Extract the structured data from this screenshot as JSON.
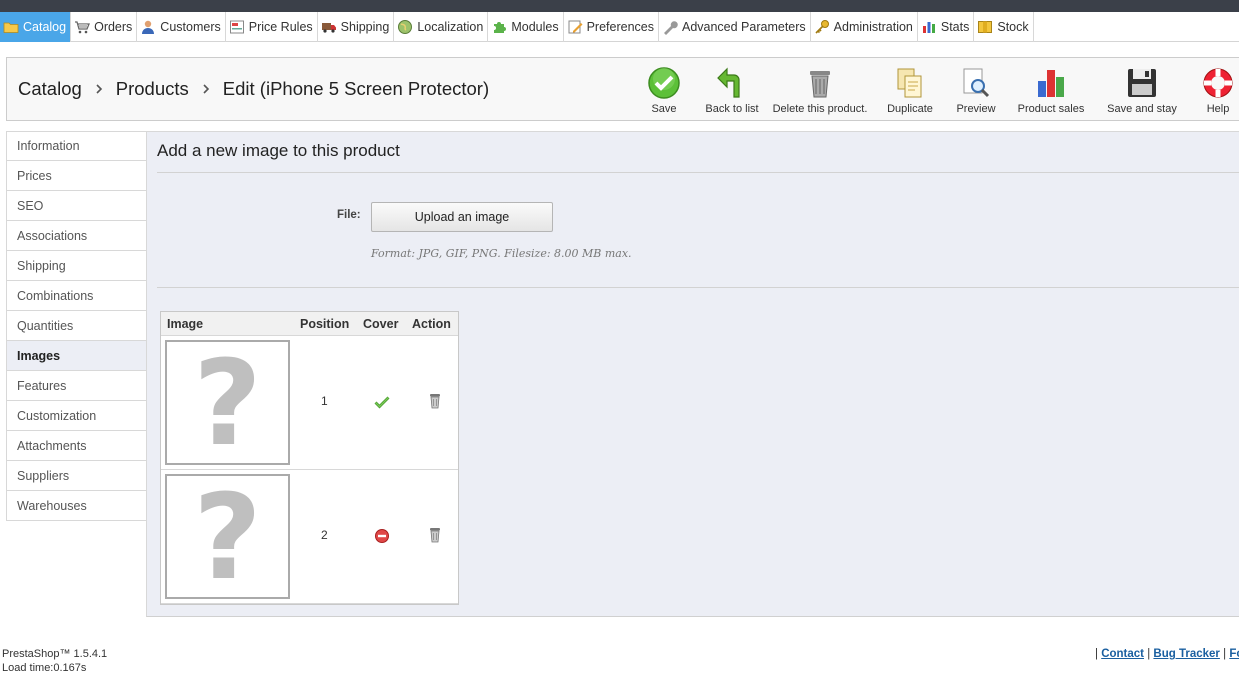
{
  "menu": {
    "items": [
      {
        "label": "Catalog",
        "icon": "folder-icon",
        "active": true
      },
      {
        "label": "Orders",
        "icon": "cart-icon"
      },
      {
        "label": "Customers",
        "icon": "customer-icon"
      },
      {
        "label": "Price Rules",
        "icon": "price-tag-icon"
      },
      {
        "label": "Shipping",
        "icon": "truck-icon"
      },
      {
        "label": "Localization",
        "icon": "globe-icon"
      },
      {
        "label": "Modules",
        "icon": "puzzle-icon"
      },
      {
        "label": "Preferences",
        "icon": "edit-form-icon"
      },
      {
        "label": "Advanced Parameters",
        "icon": "wrench-icon"
      },
      {
        "label": "Administration",
        "icon": "key-icon"
      },
      {
        "label": "Stats",
        "icon": "bar-chart-icon"
      },
      {
        "label": "Stock",
        "icon": "box-icon"
      }
    ]
  },
  "breadcrumb": {
    "level1": "Catalog",
    "level2": "Products",
    "level3": "Edit (iPhone 5 Screen Protector)"
  },
  "toolbar": {
    "save": "Save",
    "back": "Back to list",
    "delete": "Delete this product.",
    "duplicate": "Duplicate",
    "preview": "Preview",
    "sales": "Product sales",
    "save_stay": "Save and stay",
    "help": "Help"
  },
  "tabs": [
    {
      "label": "Information"
    },
    {
      "label": "Prices"
    },
    {
      "label": "SEO"
    },
    {
      "label": "Associations"
    },
    {
      "label": "Shipping"
    },
    {
      "label": "Combinations"
    },
    {
      "label": "Quantities"
    },
    {
      "label": "Images",
      "active": true
    },
    {
      "label": "Features"
    },
    {
      "label": "Customization"
    },
    {
      "label": "Attachments"
    },
    {
      "label": "Suppliers"
    },
    {
      "label": "Warehouses"
    }
  ],
  "content": {
    "title": "Add a new image to this product",
    "file_label": "File:",
    "upload_label": "Upload an image",
    "format_hint": "Format: JPG, GIF, PNG. Filesize: 8.00 MB max."
  },
  "image_table": {
    "headers": {
      "image": "Image",
      "position": "Position",
      "cover": "Cover",
      "action": "Action"
    },
    "placeholder_glyph": "?",
    "rows": [
      {
        "position": "1",
        "cover": true
      },
      {
        "position": "2",
        "cover": false
      }
    ]
  },
  "footer": {
    "version": "PrestaShop™ 1.5.4.1",
    "load_time": "Load time:0.167s",
    "sep": "|",
    "contact": "Contact",
    "bug": "Bug Tracker",
    "forum": "Fo"
  },
  "colors": {
    "active_menu": "#4aa6e8",
    "panel_bg": "#eceef5",
    "link": "#1a5fa0"
  }
}
